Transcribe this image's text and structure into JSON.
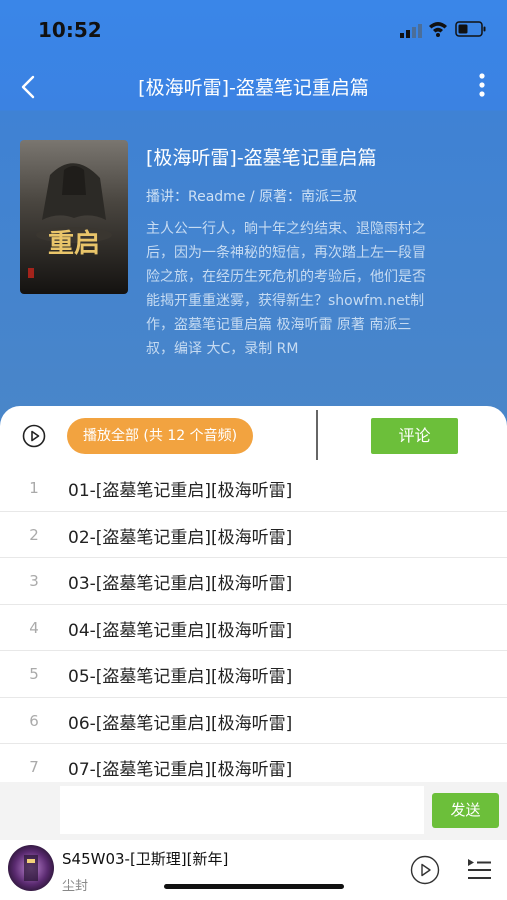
{
  "status_bar": {
    "time": "10:52"
  },
  "nav": {
    "title": "[极海听雷]-盗墓笔记重启篇"
  },
  "album": {
    "title": "[极海听雷]-盗墓笔记重启篇",
    "credits": "播讲：Readme / 原著：南派三叔",
    "description": "主人公一行人，晌十年之约结束、退隐雨村之后，因为一条神秘的短信，再次踏上左一段冒险之旅，在经历生死危机的考验后，他们是否能揭开重重迷雾，获得新生？showfm.net制作，盗墓笔记重启篇 极海听雷 原著 南派三叔，编译 大C，录制 RM",
    "cover_text": "重启"
  },
  "actions": {
    "play_all_label": "播放全部 (共 12 个音频)",
    "comment_label": "评论"
  },
  "tracks": [
    {
      "index": "1",
      "title": "01-[盗墓笔记重启][极海听雷]"
    },
    {
      "index": "2",
      "title": "02-[盗墓笔记重启][极海听雷]"
    },
    {
      "index": "3",
      "title": "03-[盗墓笔记重启][极海听雷]"
    },
    {
      "index": "4",
      "title": "04-[盗墓笔记重启][极海听雷]"
    },
    {
      "index": "5",
      "title": "05-[盗墓笔记重启][极海听雷]"
    },
    {
      "index": "6",
      "title": "06-[盗墓笔记重启][极海听雷]"
    },
    {
      "index": "7",
      "title": "07-[盗墓笔记重启][极海听雷]"
    }
  ],
  "comment_box": {
    "placeholder": "",
    "send_label": "发送"
  },
  "player": {
    "title": "S45W03-[卫斯理][新年]",
    "subtitle": "尘封"
  },
  "colors": {
    "nav_blue": "#3a86e8",
    "header_blue": "#4a86c8",
    "orange": "#f2a340",
    "green": "#6cbf3a"
  }
}
